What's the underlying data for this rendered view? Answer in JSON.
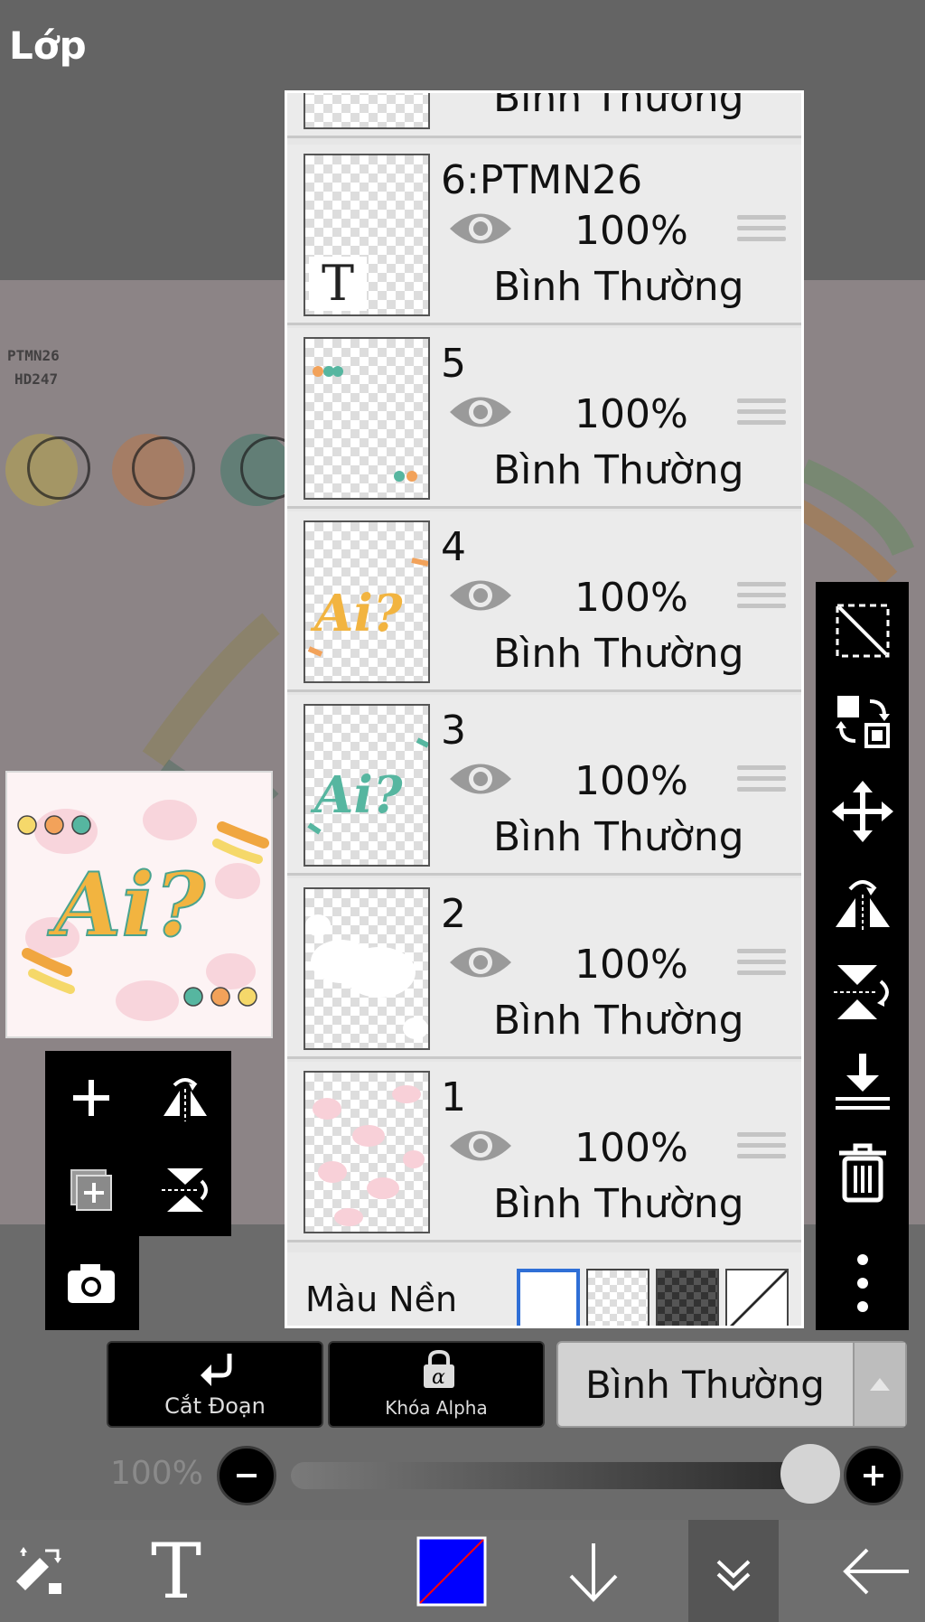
{
  "page": {
    "title": "Lớp"
  },
  "canvas": {
    "text_line_1": "PTMN26",
    "text_line_2": "HD247"
  },
  "preview": {
    "art_text": "Ai?"
  },
  "layers": [
    {
      "name": "",
      "opacity": "",
      "blend": "Bình Thường"
    },
    {
      "name": "6:PTMN26",
      "opacity": "100%",
      "blend": "Bình Thường",
      "thumb_badge": "T"
    },
    {
      "name": "5",
      "opacity": "100%",
      "blend": "Bình Thường"
    },
    {
      "name": "4",
      "opacity": "100%",
      "blend": "Bình Thường",
      "thumb_art": "Ai?"
    },
    {
      "name": "3",
      "opacity": "100%",
      "blend": "Bình Thường",
      "thumb_art": "Ai?"
    },
    {
      "name": "2",
      "opacity": "100%",
      "blend": "Bình Thường"
    },
    {
      "name": "1",
      "opacity": "100%",
      "blend": "Bình Thường"
    }
  ],
  "background_row": {
    "label": "Màu Nền"
  },
  "actions": {
    "clip_label": "Cắt Đoạn",
    "alpha_lock_label": "Khóa Alpha"
  },
  "blend_mode": {
    "value": "Bình Thường"
  },
  "opacity": {
    "label": "100%",
    "value_fraction": 1.0
  },
  "bottom_nav": {
    "text_tool_glyph": "T"
  },
  "colors": {
    "primary_color": "#0000ff",
    "accent_red": "#ff0000",
    "panel_bg": "#e6e6e6"
  },
  "icons": [
    "transform-icon",
    "text-icon",
    "color-swatch-icon",
    "arrow-down-icon",
    "collapse-icon",
    "back-icon",
    "add-layer-icon",
    "flip-horizontal-icon",
    "copy-layer-icon",
    "flip-vertical-icon",
    "camera-icon",
    "select-transparent-icon",
    "swap-layers-icon",
    "move-icon",
    "merge-down-icon",
    "trash-icon",
    "more-icon",
    "eye-icon",
    "drag-handle-icon"
  ]
}
